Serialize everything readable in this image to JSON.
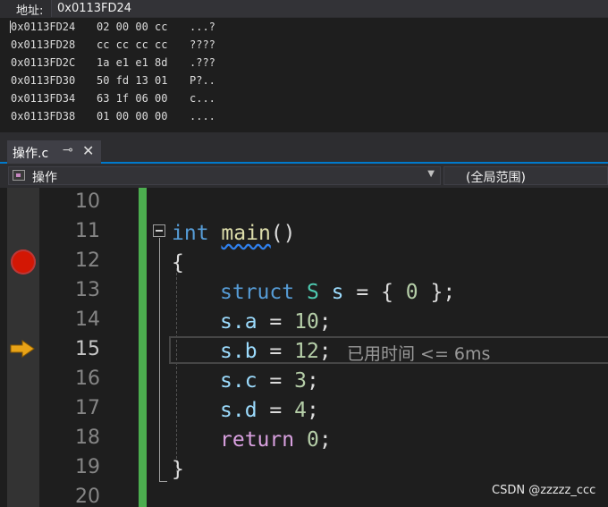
{
  "memory": {
    "address_label": "地址:",
    "address_value": "0x0113FD24",
    "rows": [
      {
        "addr": "0x0113FD24",
        "bytes": "02 00 00 cc",
        "ascii": "...?"
      },
      {
        "addr": "0x0113FD28",
        "bytes": "cc cc cc cc",
        "ascii": "????"
      },
      {
        "addr": "0x0113FD2C",
        "bytes": "1a e1 e1 8d",
        "ascii": ".???"
      },
      {
        "addr": "0x0113FD30",
        "bytes": "50 fd 13 01",
        "ascii": "P?.."
      },
      {
        "addr": "0x0113FD34",
        "bytes": "63 1f 06 00",
        "ascii": "c..."
      },
      {
        "addr": "0x0113FD38",
        "bytes": "01 00 00 00",
        "ascii": "...."
      }
    ]
  },
  "tab": {
    "label": "操作.c",
    "pin_icon": "⊸",
    "close_icon": "✕"
  },
  "nav": {
    "scope_left": "操作",
    "scope_right": "(全局范围)",
    "dropdown_icon": "▼"
  },
  "editor": {
    "line_numbers": [
      "10",
      "11",
      "12",
      "13",
      "14",
      "15",
      "16",
      "17",
      "18",
      "19",
      "20"
    ],
    "current_line": "15",
    "code": {
      "l11_type": "int",
      "l11_name": "main",
      "l11_parens": "()",
      "l12": "{",
      "l13_kw": "struct",
      "l13_type": "S",
      "l13_var": "s",
      "l13_rest": " = { ",
      "l13_num": "0",
      "l13_end": " };",
      "l14_var": "s.a",
      "l14_op": " = ",
      "l14_num": "10",
      "l15_var": "s.b",
      "l15_op": " = ",
      "l15_num": "12",
      "l16_var": "s.c",
      "l16_op": " = ",
      "l16_num": "3",
      "l17_var": "s.d",
      "l17_op": " = ",
      "l17_num": "4",
      "l18_kw": "return",
      "l18_num": "0",
      "semicolon": ";",
      "l19": "}"
    },
    "perf_tip": "已用时间 <= 6ms"
  },
  "watermark": "CSDN @zzzzz_ccc",
  "colors": {
    "breakpoint": "#e51400",
    "arrow": "#e8a317",
    "change_bar": "#4cae4f",
    "keyword": "#569cd6",
    "function": "#dcdcaa"
  }
}
